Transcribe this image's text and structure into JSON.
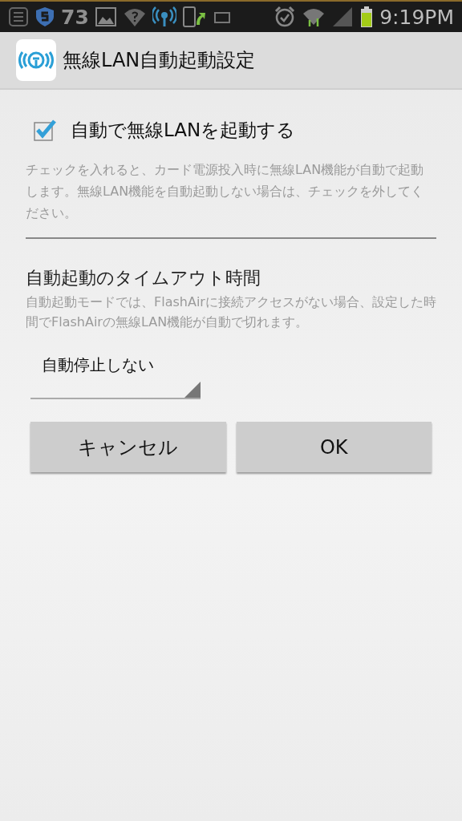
{
  "status_bar": {
    "count": "73",
    "time": "9:19PM"
  },
  "app_bar": {
    "title": "無線LAN自動起動設定"
  },
  "auto_start": {
    "label": "自動で無線LANを起動する",
    "checked": true,
    "description": "チェックを入れると、カード電源投入時に無線LAN機能が自動で起動します。無線LAN機能を自動起動しない場合は、チェックを外してください。"
  },
  "timeout": {
    "heading": "自動起動のタイムアウト時間",
    "description": "自動起動モードでは、FlashAirに接続アクセスがない場合、設定した時間でFlashAirの無線LAN機能が自動で切れます。",
    "spinner": {
      "value": "自動停止しない"
    }
  },
  "buttons": [
    {
      "label": "キャンセル"
    },
    {
      "label": "OK"
    }
  ]
}
